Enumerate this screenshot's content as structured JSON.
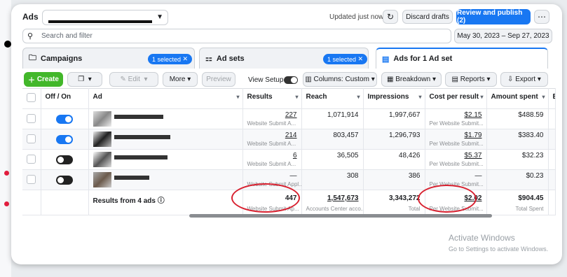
{
  "header": {
    "app_title": "Ads",
    "updated_text": "Updated just now",
    "discard_label": "Discard drafts",
    "publish_label": "Review and publish (2)",
    "more_icon": "ellipsis-icon",
    "refresh_icon": "refresh-icon"
  },
  "search": {
    "placeholder": "Search and filter",
    "date_range": "May 30, 2023 – Sep 27, 2023"
  },
  "tabs": [
    {
      "label": "Campaigns",
      "badge": "1 selected"
    },
    {
      "label": "Ad sets",
      "badge": "1 selected"
    },
    {
      "label": "Ads for 1 Ad set"
    }
  ],
  "toolbar": {
    "create": "Create",
    "edit": "Edit",
    "more": "More",
    "preview": "Preview",
    "view_setup": "View Setup",
    "columns": "Columns: Custom",
    "breakdown": "Breakdown",
    "reports": "Reports",
    "export": "Export"
  },
  "table": {
    "headers": [
      "Off / On",
      "Ad",
      "Results",
      "Reach",
      "Impressions",
      "Cost per result",
      "Amount spent",
      "En"
    ],
    "rows": [
      {
        "on": true,
        "results": "227",
        "results_sub": "Website Submit A...",
        "reach": "1,071,914",
        "impressions": "1,997,667",
        "cpr": "$2.15",
        "cpr_sub": "Per Website Submit...",
        "spent": "$488.59"
      },
      {
        "on": true,
        "results": "214",
        "results_sub": "Website Submit A...",
        "reach": "803,457",
        "impressions": "1,296,793",
        "cpr": "$1.79",
        "cpr_sub": "Per Website Submit...",
        "spent": "$383.40"
      },
      {
        "on": false,
        "results": "6",
        "results_sub": "Website Submit A...",
        "reach": "36,505",
        "impressions": "48,426",
        "cpr": "$5.37",
        "cpr_sub": "Per Website Submit...",
        "spent": "$32.23"
      },
      {
        "on": false,
        "results": "—",
        "results_sub": "Website Submit Appl...",
        "reach": "308",
        "impressions": "386",
        "cpr": "—",
        "cpr_sub": "Per Website Submit...",
        "spent": "$0.23"
      }
    ],
    "summary": {
      "label": "Results from 4 ads",
      "results": "447",
      "results_sub": "Website Submit Ap...",
      "reach": "1,547,673",
      "reach_sub": "Accounts Center acco...",
      "impressions": "3,343,272",
      "impressions_sub": "Total",
      "cpr": "$2.02",
      "cpr_sub": "Per Website Submit...",
      "spent": "$904.45",
      "spent_sub": "Total Spent"
    }
  },
  "watermark": {
    "title": "Activate Windows",
    "sub": "Go to Settings to activate Windows."
  },
  "colors": {
    "accent": "#1877f2",
    "create": "#42b72a",
    "annotation": "#d8202f"
  }
}
